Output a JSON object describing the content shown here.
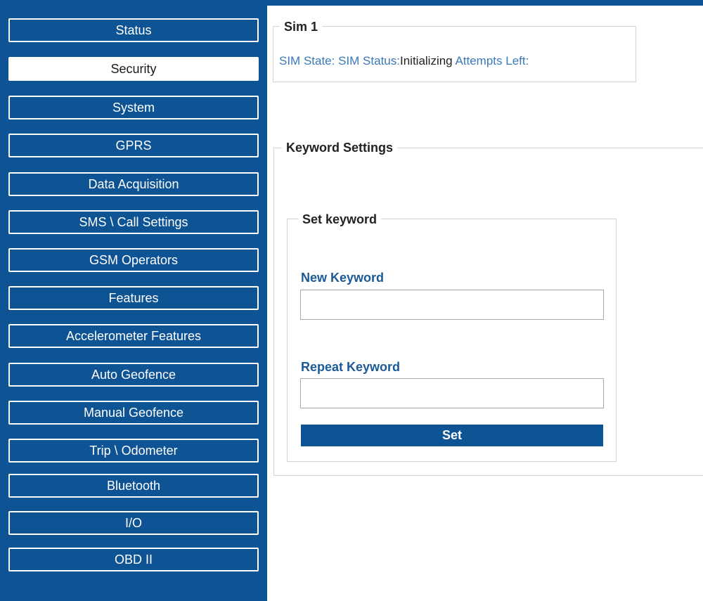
{
  "sidebar": {
    "items": [
      {
        "label": "Status"
      },
      {
        "label": "Security",
        "active": true
      },
      {
        "label": "System"
      },
      {
        "label": "GPRS"
      },
      {
        "label": "Data Acquisition"
      },
      {
        "label": "SMS \\ Call Settings"
      },
      {
        "label": "GSM Operators"
      },
      {
        "label": "Features"
      },
      {
        "label": "Accelerometer Features"
      },
      {
        "label": "Auto Geofence"
      },
      {
        "label": "Manual Geofence"
      },
      {
        "label": "Trip \\ Odometer"
      },
      {
        "label": "Bluetooth"
      },
      {
        "label": "I/O"
      },
      {
        "label": "OBD II"
      }
    ]
  },
  "sim": {
    "title": "Sim 1",
    "state_label": "SIM State:",
    "state_value": "",
    "status_label": "SIM Status:",
    "status_value": "Initializing",
    "attempts_label": "Attempts Left:",
    "attempts_value": ""
  },
  "keyword_settings": {
    "title": "Keyword Settings",
    "set_keyword": {
      "title": "Set keyword",
      "new_keyword_label": "New Keyword",
      "new_keyword_value": "",
      "repeat_keyword_label": "Repeat Keyword",
      "repeat_keyword_value": "",
      "set_button_label": "Set"
    }
  },
  "colors": {
    "brand_blue": "#0e5393",
    "label_blue": "#3a78b8",
    "field_label_blue": "#1c5a97"
  }
}
